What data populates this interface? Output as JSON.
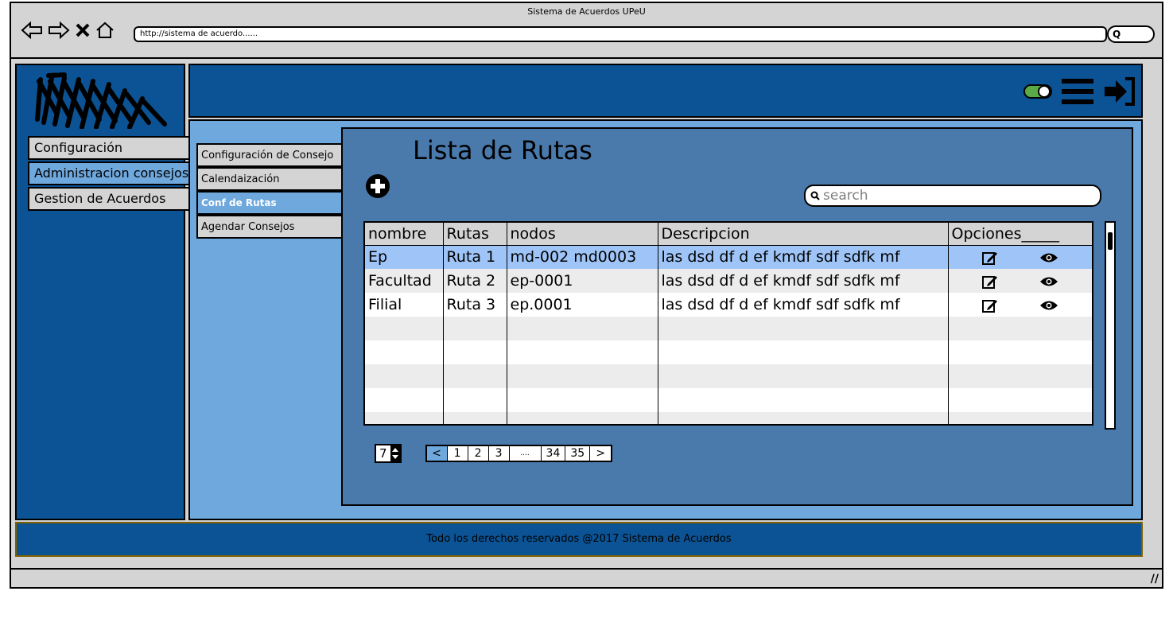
{
  "window": {
    "title": "Sistema de Acuerdos UPeU",
    "url": "http://sistema de acuerdo......",
    "search_pill": "Q"
  },
  "sidebar": {
    "items": [
      {
        "label": "Configuración"
      },
      {
        "label": "Administracion consejos"
      },
      {
        "label": "Gestion de Acuerdos"
      }
    ]
  },
  "submenu": {
    "items": [
      {
        "label": "Configuración de Consejo"
      },
      {
        "label": "Calendaización"
      },
      {
        "label": "Conf de Rutas"
      },
      {
        "label": "Agendar Consejos"
      }
    ]
  },
  "main": {
    "title": "Lista de Rutas",
    "search_placeholder": "search",
    "table": {
      "columns": [
        "nombre",
        "Rutas",
        "nodos",
        "Descripcion",
        "Opciones_____"
      ],
      "rows": [
        {
          "nombre": "Ep",
          "rutas": "Ruta 1",
          "nodos": "md-002 md0003",
          "descripcion": "las dsd df d ef kmdf sdf sdfk mf"
        },
        {
          "nombre": "Facultad",
          "rutas": "Ruta 2",
          "nodos": "ep-0001",
          "descripcion": "las dsd df d ef kmdf sdf sdfk mf"
        },
        {
          "nombre": "Filial",
          "rutas": "Ruta 3",
          "nodos": "ep.0001",
          "descripcion": "las dsd df d ef kmdf sdf sdfk mf"
        }
      ]
    },
    "page_size": "7",
    "pagination": [
      "<",
      "1",
      "2",
      "3",
      "....",
      "34",
      "35",
      ">"
    ]
  },
  "footer": {
    "text": "Todo los derechos reservados @2017 Sistema de Acuerdos"
  },
  "colors": {
    "dark_blue": "#0b5394",
    "light_blue": "#6fa8dc",
    "panel_blue": "#4a79ab",
    "selected_row": "#9fc5f8",
    "toggle_green": "#5aaa47"
  }
}
